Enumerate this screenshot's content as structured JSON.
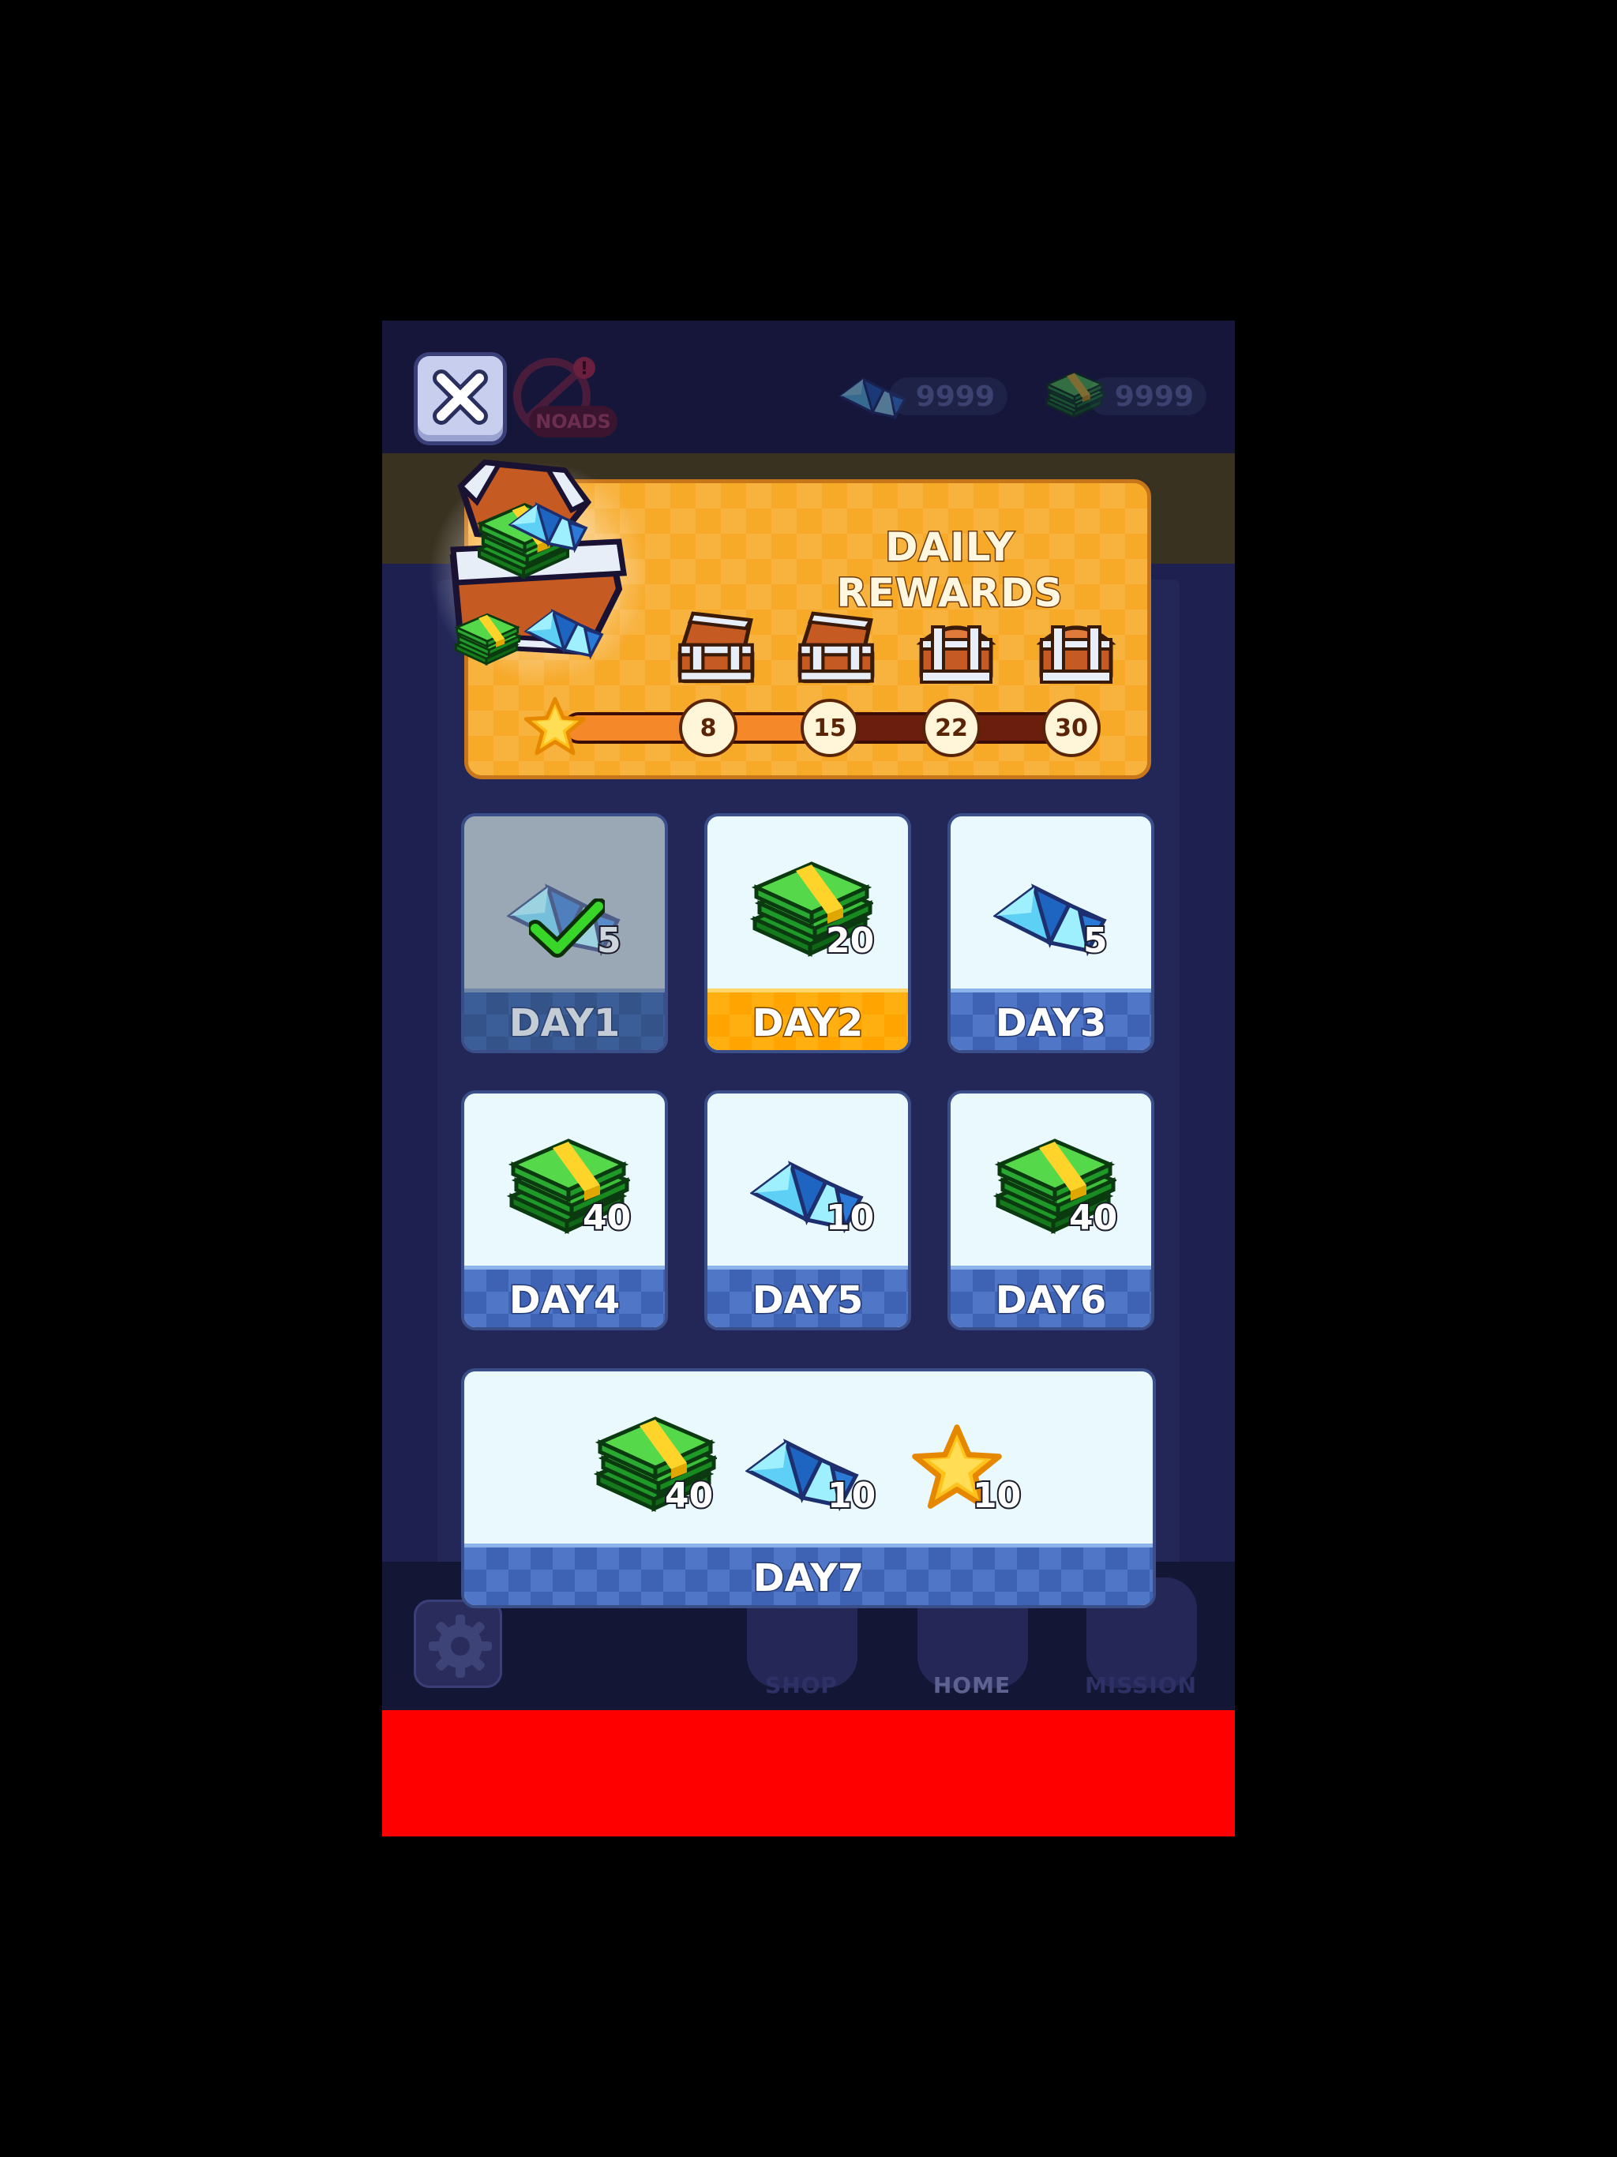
{
  "hud": {
    "noads_label": "NOADS",
    "gems_count": "9999",
    "cash_count": "9999"
  },
  "nav": {
    "shop_label": "SHOP",
    "home_label": "HOME",
    "mission_label": "MISSION"
  },
  "panel": {
    "title": "DAILY REWARDS",
    "milestones": [
      "8",
      "15",
      "22",
      "30"
    ],
    "streak_progress": 0
  },
  "days": [
    {
      "label": "DAY1",
      "reward": "gem-icon",
      "qty": "5",
      "state": "claimed"
    },
    {
      "label": "DAY2",
      "reward": "cash-icon",
      "qty": "20",
      "state": "current"
    },
    {
      "label": "DAY3",
      "reward": "gem-icon",
      "qty": "5",
      "state": "locked"
    },
    {
      "label": "DAY4",
      "reward": "cash-icon",
      "qty": "40",
      "state": "locked"
    },
    {
      "label": "DAY5",
      "reward": "gem-icon",
      "qty": "10",
      "state": "locked"
    },
    {
      "label": "DAY6",
      "reward": "cash-icon",
      "qty": "40",
      "state": "locked"
    },
    {
      "label": "DAY7",
      "rewards": [
        {
          "reward": "cash-icon",
          "qty": "40"
        },
        {
          "reward": "gem-icon",
          "qty": "10"
        },
        {
          "reward": "star-icon",
          "qty": "10"
        }
      ],
      "state": "locked"
    }
  ],
  "colors": {
    "panel_orange": "#f7a928",
    "card_bg": "#eaf9fd",
    "strip_blue": "#4f76c7",
    "strip_current": "#ffb010",
    "progress_fill": "#f5892a",
    "progress_track": "#6b1d0e",
    "ad_banner": "#ff0000"
  }
}
